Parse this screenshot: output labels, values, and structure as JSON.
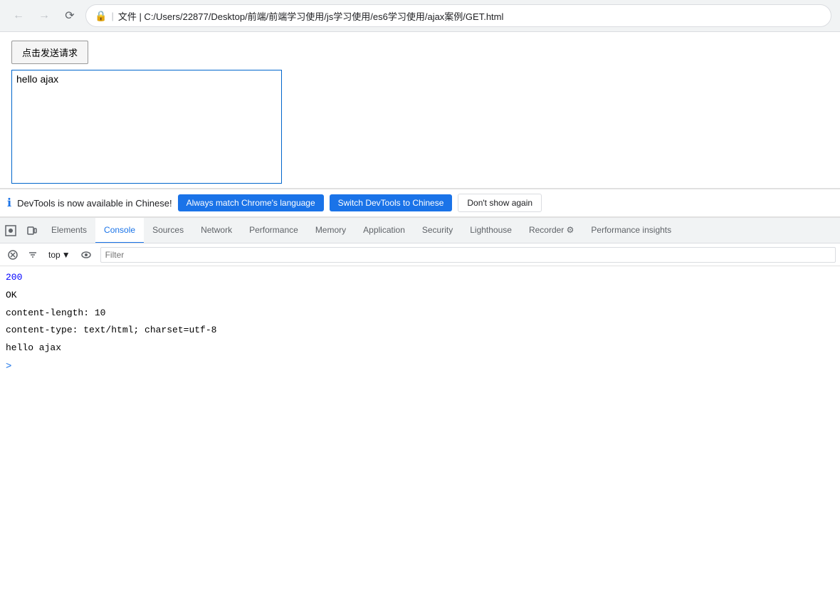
{
  "browser": {
    "url": "文件  |  C:/Users/22877/Desktop/前端/前端学习使用/js学习使用/es6学习使用/ajax案例/GET.html",
    "url_display": "文件 | C:/Users/22877/Desktop/前端/前端学习使用/js学习使用/es6学习使用/ajax案例/GET.html"
  },
  "page": {
    "button_label": "点击发送请求",
    "response_text": "hello ajax"
  },
  "notification": {
    "message": "DevTools is now available in Chinese!",
    "btn_match": "Always match Chrome's language",
    "btn_switch": "Switch DevTools to Chinese",
    "btn_dismiss": "Don't show again"
  },
  "devtools": {
    "tabs": [
      {
        "label": "Elements",
        "active": false
      },
      {
        "label": "Console",
        "active": true
      },
      {
        "label": "Sources",
        "active": false
      },
      {
        "label": "Network",
        "active": false
      },
      {
        "label": "Performance",
        "active": false
      },
      {
        "label": "Memory",
        "active": false
      },
      {
        "label": "Application",
        "active": false
      },
      {
        "label": "Security",
        "active": false
      },
      {
        "label": "Lighthouse",
        "active": false
      },
      {
        "label": "Recorder ⚙",
        "active": false
      },
      {
        "label": "Performance insights",
        "active": false
      }
    ],
    "console": {
      "context": "top",
      "filter_placeholder": "Filter",
      "lines": [
        {
          "text": "200",
          "class": "blue"
        },
        {
          "text": "OK",
          "class": "black"
        },
        {
          "text": "content-length: 10",
          "class": "black"
        },
        {
          "text": "content-type: text/html; charset=utf-8",
          "class": "black"
        },
        {
          "text": "hello ajax",
          "class": "black"
        },
        {
          "text": ">",
          "class": "prompt"
        }
      ]
    }
  }
}
